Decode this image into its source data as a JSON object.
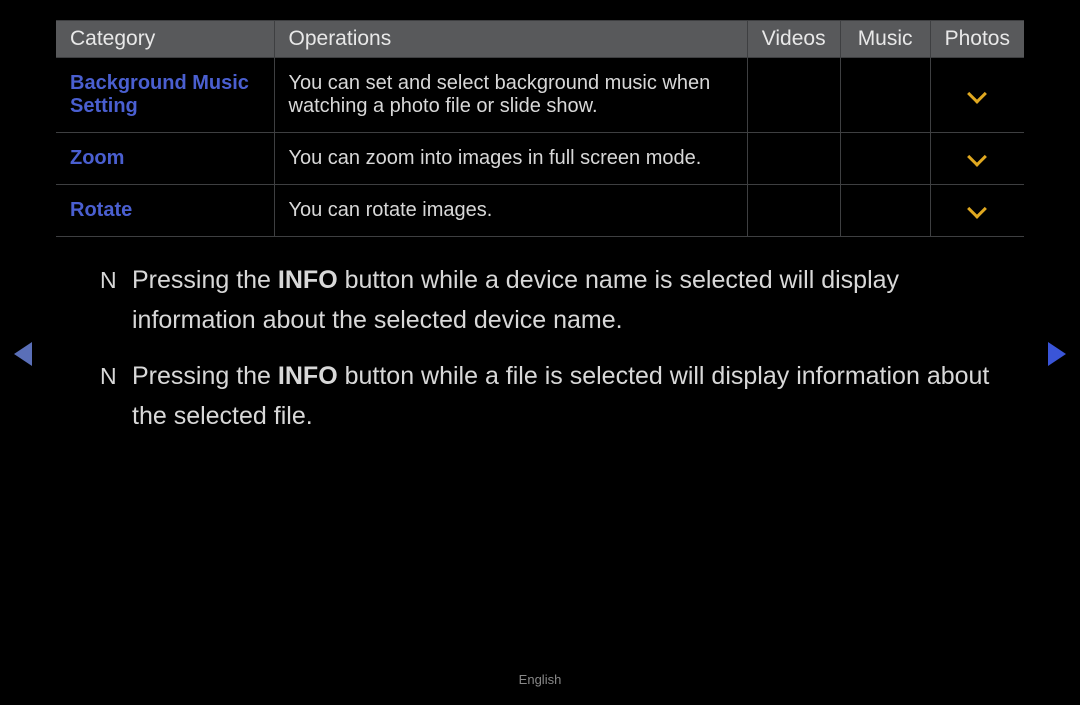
{
  "table": {
    "headers": {
      "category": "Category",
      "operations": "Operations",
      "videos": "Videos",
      "music": "Music",
      "photos": "Photos"
    },
    "rows": [
      {
        "category": "Background Music Setting",
        "operations": "You can set and select background music when watching a photo file or slide show.",
        "videos": "",
        "music": "",
        "photos_check": true
      },
      {
        "category": "Zoom",
        "operations": "You can zoom into images in full screen mode.",
        "videos": "",
        "music": "",
        "photos_check": true
      },
      {
        "category": "Rotate",
        "operations": "You can rotate images.",
        "videos": "",
        "music": "",
        "photos_check": true
      }
    ]
  },
  "notes": [
    {
      "pre": "Pressing the ",
      "bold": "INFO",
      "post": " button while a device name is selected will display information about the selected device name."
    },
    {
      "pre": "Pressing the ",
      "bold": "INFO",
      "post": " button while a file is selected will display information about the selected file."
    }
  ],
  "bullet": "N",
  "footer": "English"
}
